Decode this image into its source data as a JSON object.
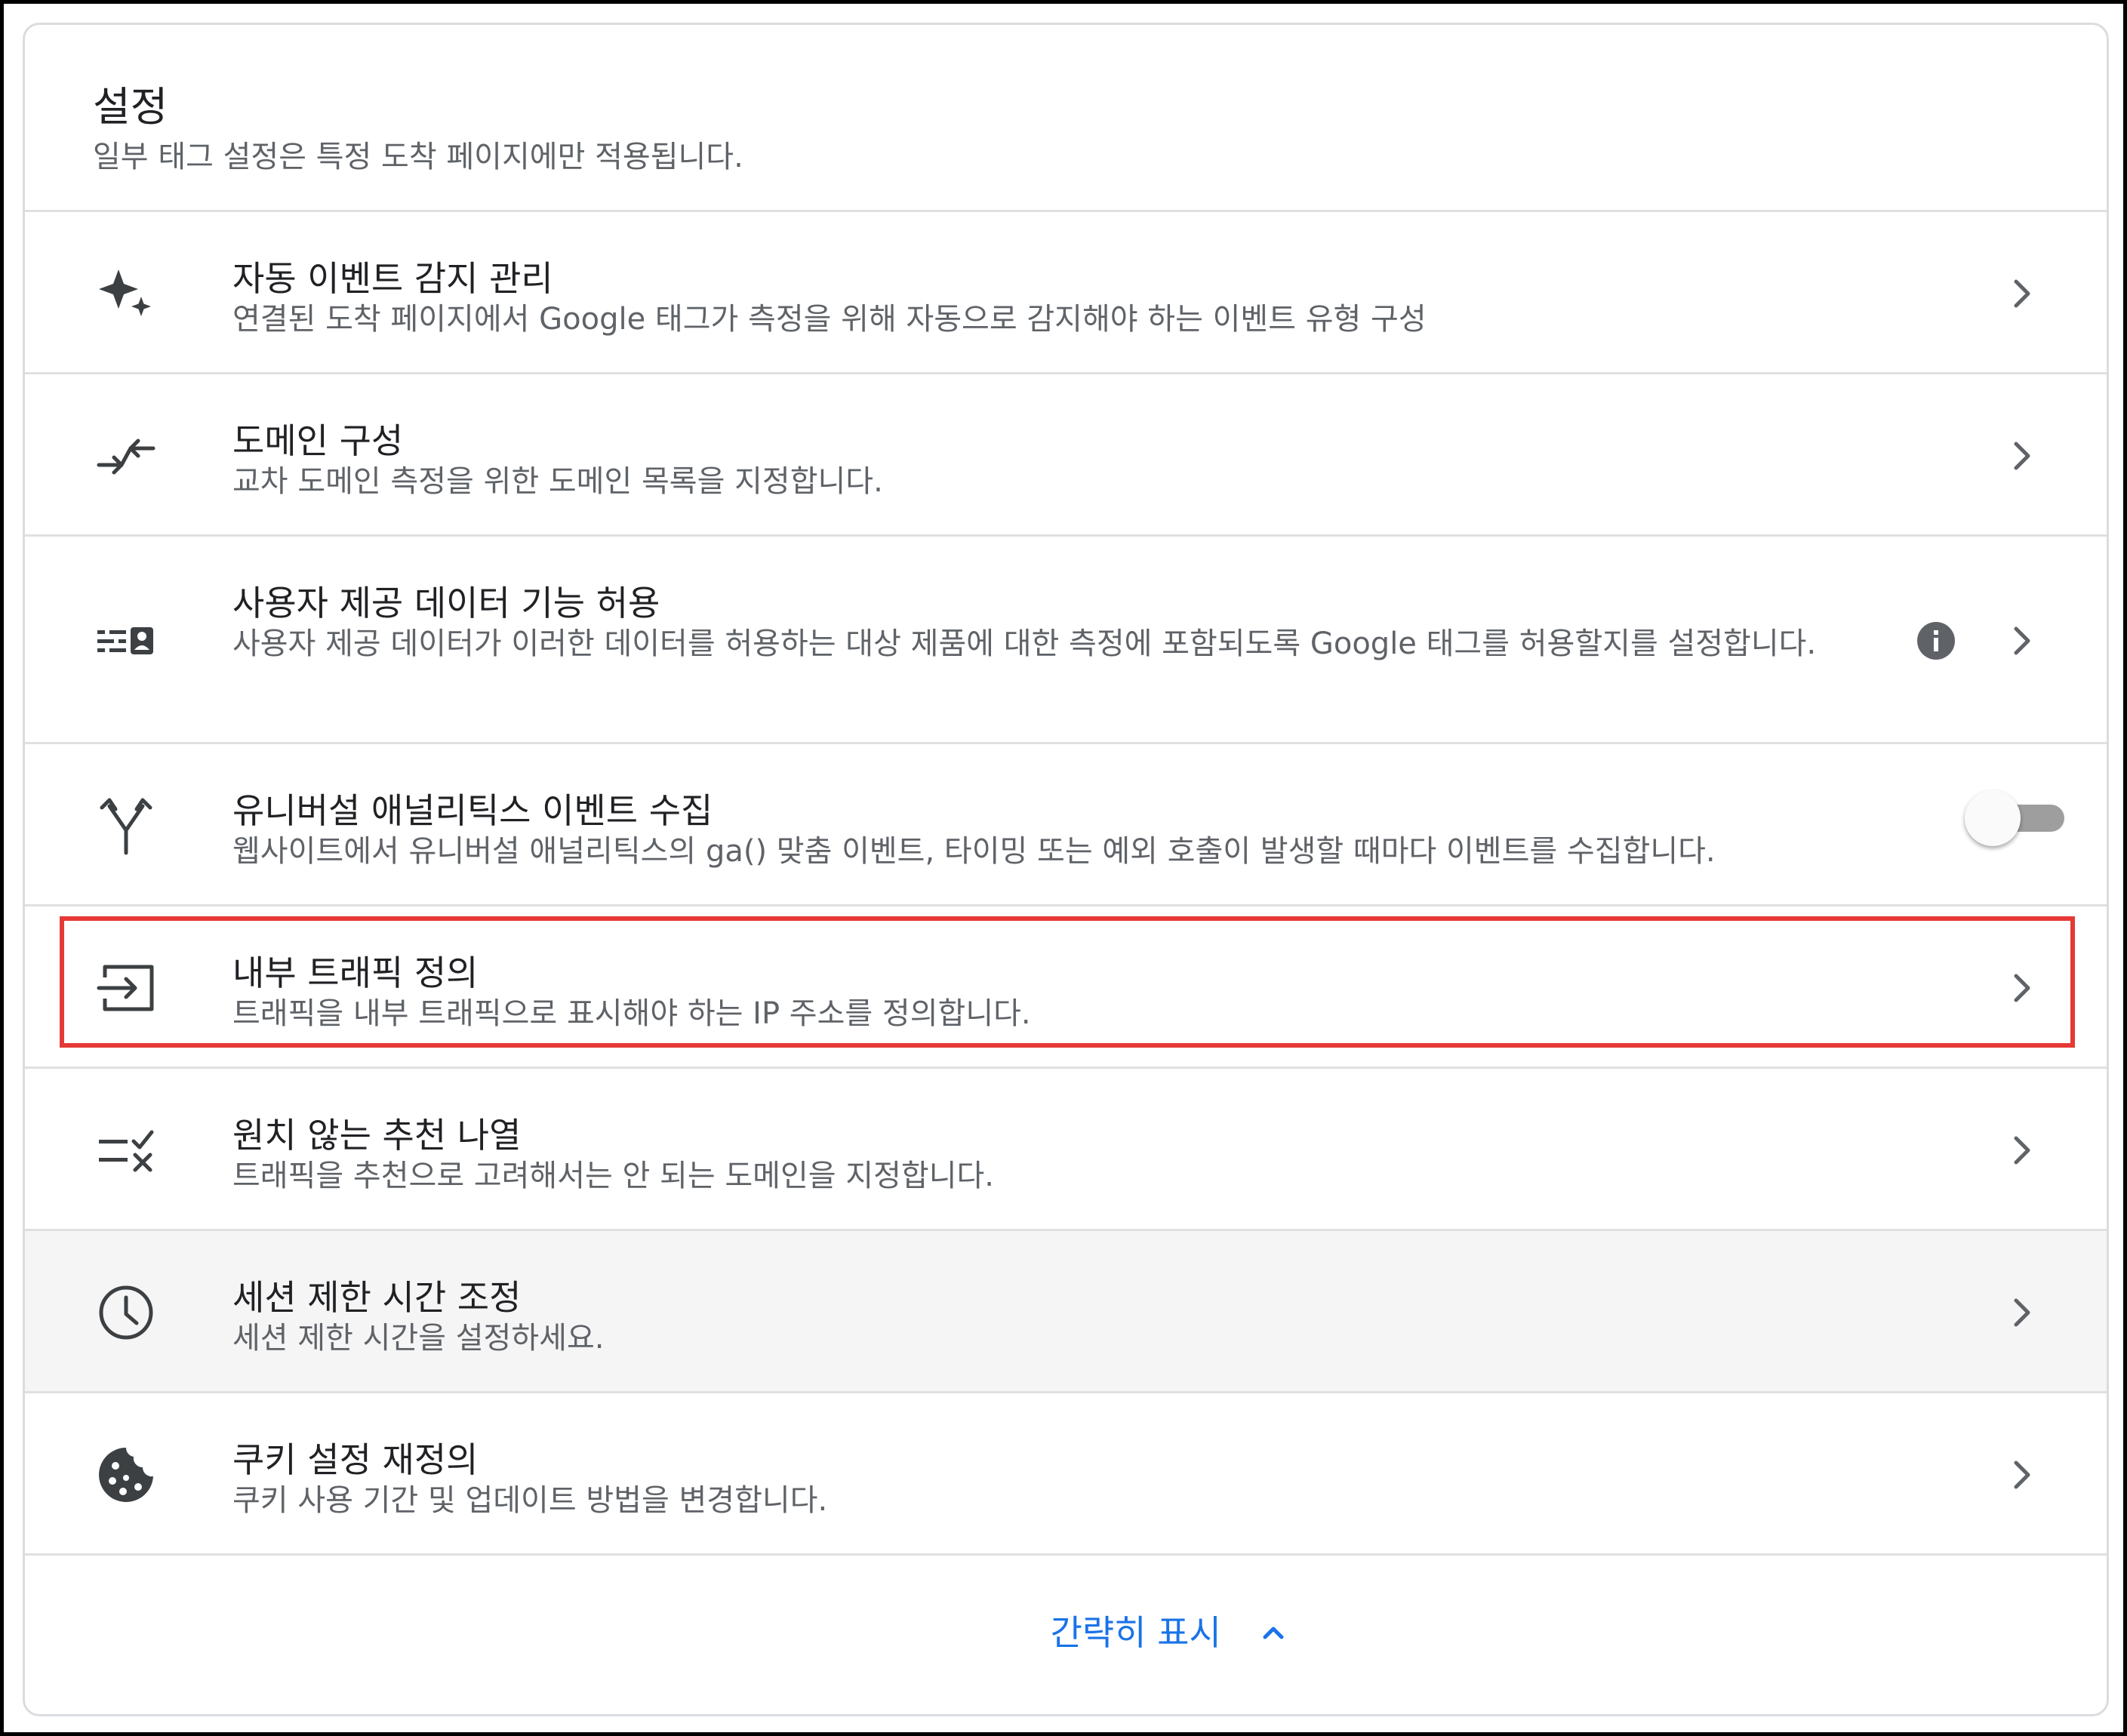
{
  "header": {
    "title": "설정",
    "subtitle": "일부 태그 설정은 특정 도착 페이지에만 적용됩니다."
  },
  "settings": [
    {
      "icon": "sparkle-icon",
      "title": "자동 이벤트 감지 관리",
      "description": "연결된 도착 페이지에서 Google 태그가 측정을 위해 자동으로 감지해야 하는 이벤트 유형 구성"
    },
    {
      "icon": "domain-merge-icon",
      "title": "도메인 구성",
      "description": "교차 도메인 측정을 위한 도메인 목록을 지정합니다."
    },
    {
      "icon": "user-data-icon",
      "title": "사용자 제공 데이터 기능 허용",
      "description": "사용자 제공 데이터가 이러한 데이터를 허용하는 대상 제품에 대한 측정에 포함되도록 Google 태그를 허용할지를 설정합니다."
    },
    {
      "icon": "merge-arrows-icon",
      "title": "유니버설 애널리틱스 이벤트 수집",
      "description": "웹사이트에서 유니버설 애널리틱스의 ga() 맞춤 이벤트, 타이밍 또는 예외 호출이 발생할 때마다 이벤트를 수집합니다.",
      "toggle_on": false
    },
    {
      "icon": "input-arrow-icon",
      "title": "내부 트래픽 정의",
      "description": "트래픽을 내부 트래픽으로 표시해야 하는 IP 주소를 정의합니다."
    },
    {
      "icon": "rule-exclude-icon",
      "title": "원치 않는 추천 나열",
      "description": "트래픽을 추천으로 고려해서는 안 되는 도메인을 지정합니다."
    },
    {
      "icon": "clock-icon",
      "title": "세션 제한 시간 조정",
      "description": "세션 제한 시간을 설정하세요."
    },
    {
      "icon": "cookie-icon",
      "title": "쿠키 설정 재정의",
      "description": "쿠키 사용 기간 및 업데이트 방법을 변경합니다."
    }
  ],
  "footer": {
    "show_less_label": "간략히 표시"
  },
  "colors": {
    "accent": "#1a73e8",
    "highlight": "#e53935",
    "text_primary": "#202124",
    "text_secondary": "#5f6368",
    "divider": "#e0e0e0"
  }
}
